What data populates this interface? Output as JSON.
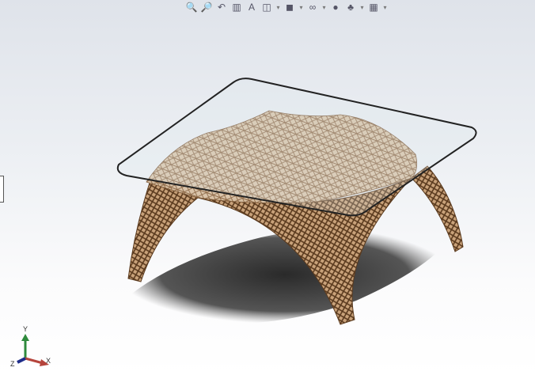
{
  "toolbar": {
    "items": [
      {
        "name": "zoom-to-fit-icon",
        "glyph": "🔍"
      },
      {
        "name": "zoom-to-area-icon",
        "glyph": "🔎"
      },
      {
        "name": "previous-view-icon",
        "glyph": "↶"
      },
      {
        "name": "section-view-icon",
        "glyph": "▥"
      },
      {
        "name": "dynamic-annotation-icon",
        "glyph": "A"
      },
      {
        "name": "view-orientation-icon",
        "glyph": "◫",
        "dropdown": true
      },
      {
        "name": "display-style-icon",
        "glyph": "◼",
        "dropdown": true
      },
      {
        "name": "hide-show-items-icon",
        "glyph": "∞",
        "dropdown": true
      },
      {
        "name": "edit-appearance-icon",
        "glyph": "●"
      },
      {
        "name": "apply-scene-icon",
        "glyph": "♣",
        "dropdown": true
      },
      {
        "name": "view-settings-icon",
        "glyph": "▦",
        "dropdown": true
      }
    ],
    "dropdown_glyph": "▾"
  },
  "triad": {
    "x": "X",
    "y": "Y",
    "z": "Z",
    "colors": {
      "x": "#b5443c",
      "y": "#2e8a3c",
      "z": "#1f2d8a"
    }
  }
}
